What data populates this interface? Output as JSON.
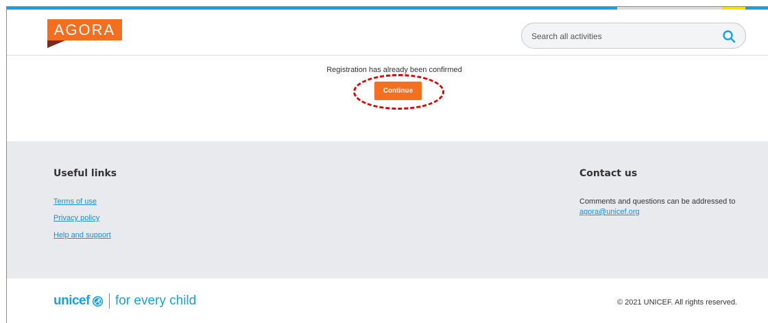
{
  "header": {
    "logo_text": "AGORA",
    "search": {
      "placeholder": "Search all activities"
    }
  },
  "main": {
    "message": "Registration has already been confirmed",
    "continue_label": "Continue"
  },
  "footer": {
    "useful_links_title": "Useful links",
    "links": [
      "Terms of use",
      "Privacy policy",
      "Help and support"
    ],
    "contact_title": "Contact us",
    "contact_text": "Comments and questions can be addressed to",
    "contact_email": "agora@unicef.org"
  },
  "bottom": {
    "brand_word": "unicef",
    "brand_tagline": "for every child",
    "copyright": "© 2021 UNICEF. All rights reserved."
  },
  "colors": {
    "accent_orange": "#f37021",
    "unicef_blue": "#1ca0db",
    "link_blue": "#1a8fd0",
    "highlight_red": "#e00000",
    "footer_bg": "#e9eaee"
  },
  "icons": [
    "search-icon",
    "unicef-emblem-icon"
  ]
}
